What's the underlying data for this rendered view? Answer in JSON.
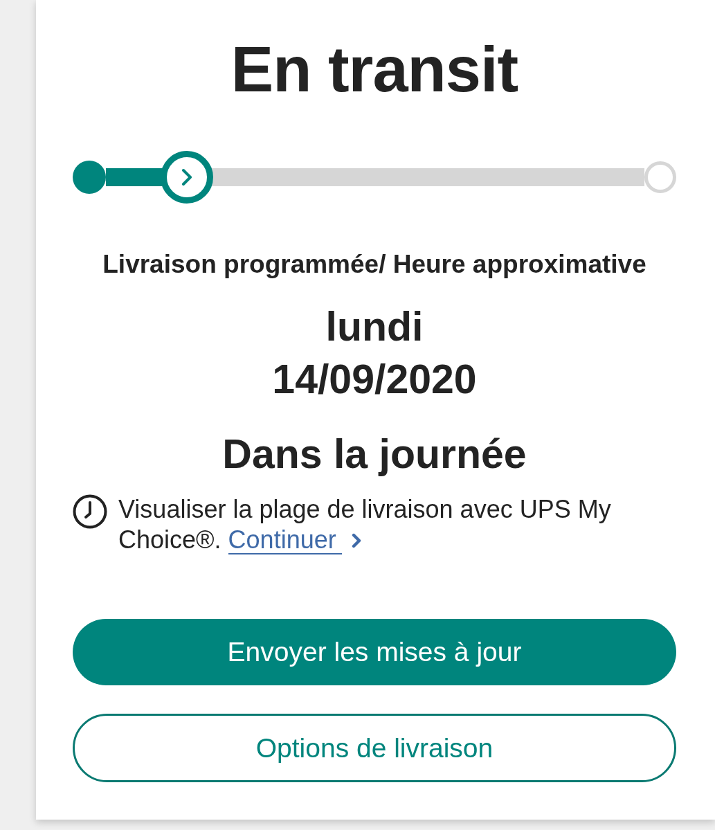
{
  "status_title": "En transit",
  "progress": {
    "level": 0.15
  },
  "delivery": {
    "label": "Livraison programmée/ Heure approximative",
    "day": "lundi",
    "date": "14/09/2020",
    "window": "Dans la journée"
  },
  "my_choice_note": {
    "text": "Visualiser la plage de livraison avec UPS My Choice®.",
    "link": "Continuer"
  },
  "buttons": [
    {
      "label": "Envoyer les mises à jour",
      "kind": "primary"
    },
    {
      "label": "Options de livraison",
      "kind": "secondary"
    }
  ]
}
